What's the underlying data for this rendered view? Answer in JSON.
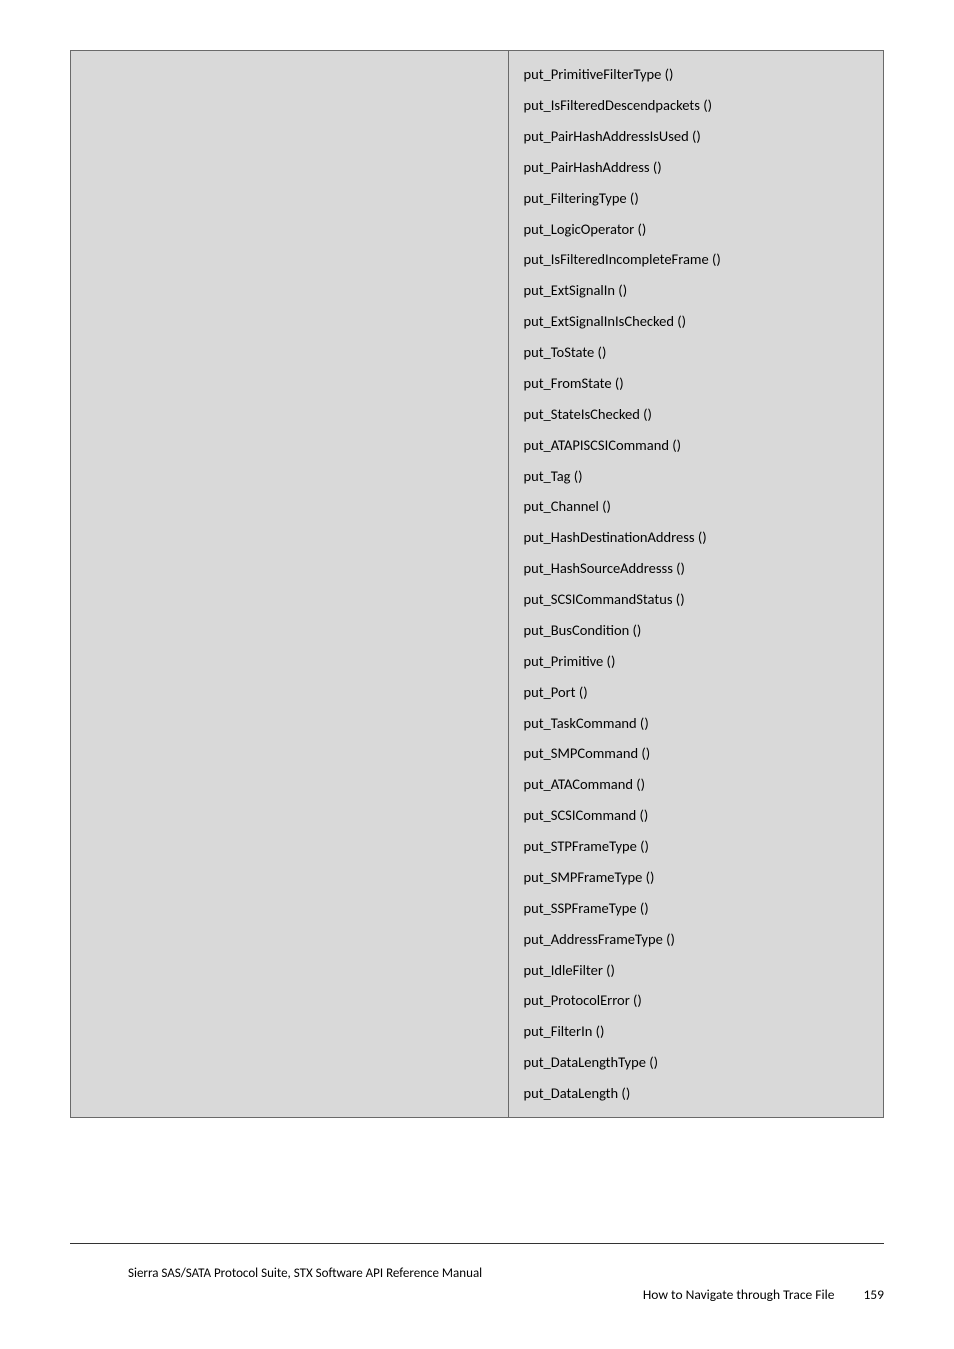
{
  "functions": [
    "put_PrimitiveFilterType ()",
    "put_IsFilteredDescendpackets ()",
    "put_PairHashAddressIsUsed ()",
    "put_PairHashAddress ()",
    "put_FilteringType ()",
    "put_LogicOperator ()",
    "put_IsFilteredIncompleteFrame ()",
    "put_ExtSignalIn ()",
    "put_ExtSignalInIsChecked ()",
    "put_ToState ()",
    "put_FromState ()",
    "put_StateIsChecked ()",
    "put_ATAPISCSICommand ()",
    "put_Tag ()",
    "put_Channel ()",
    "put_HashDestinationAddress ()",
    "put_HashSourceAddresss ()",
    "put_SCSICommandStatus ()",
    "put_BusCondition ()",
    "put_Primitive ()",
    "put_Port ()",
    "put_TaskCommand ()",
    "put_SMPCommand ()",
    "put_ATACommand ()",
    "put_SCSICommand ()",
    "put_STPFrameType ()",
    "put_SMPFrameType ()",
    "put_SSPFrameType ()",
    "put_AddressFrameType ()",
    "put_IdleFilter ()",
    "put_ProtocolError ()",
    "put_FilterIn ()",
    "put_DataLengthType ()",
    "put_DataLength ()"
  ],
  "footer": {
    "left": "Sierra SAS/SATA Protocol Suite, STX Software API Reference Manual",
    "right_text": "How to Navigate through Trace File",
    "page_number": "159"
  }
}
